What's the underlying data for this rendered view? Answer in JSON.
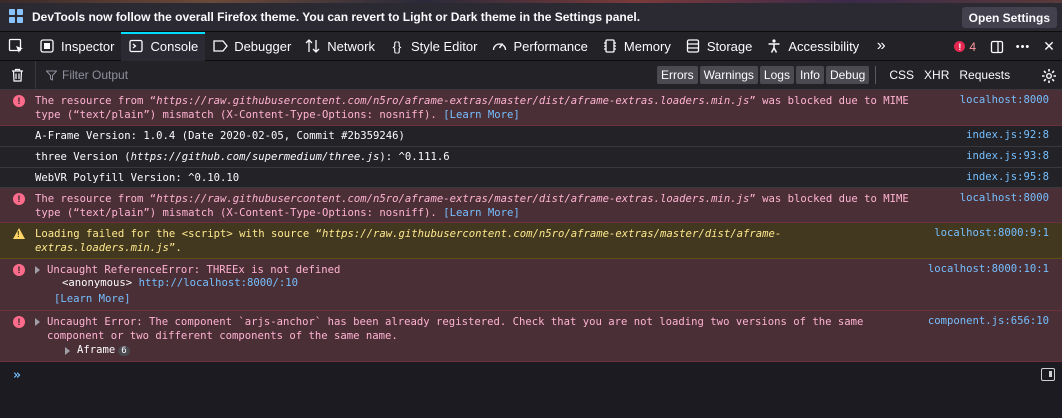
{
  "notification": {
    "text": "DevTools now follow the overall Firefox theme. You can revert to Light or Dark theme in the Settings panel.",
    "button": "Open Settings"
  },
  "toolbox": {
    "tabs": [
      {
        "label": "Inspector",
        "icon": "inspector-icon"
      },
      {
        "label": "Console",
        "icon": "console-icon"
      },
      {
        "label": "Debugger",
        "icon": "debugger-icon"
      },
      {
        "label": "Network",
        "icon": "network-icon"
      },
      {
        "label": "Style Editor",
        "icon": "style-editor-icon"
      },
      {
        "label": "Performance",
        "icon": "performance-icon"
      },
      {
        "label": "Memory",
        "icon": "memory-icon"
      },
      {
        "label": "Storage",
        "icon": "storage-icon"
      },
      {
        "label": "Accessibility",
        "icon": "accessibility-icon"
      }
    ],
    "selected_tab": "Console",
    "more": "»",
    "error_count": "4",
    "more_menu": "•••",
    "close": "✕"
  },
  "filterbar": {
    "placeholder": "Filter Output",
    "levels": [
      "Errors",
      "Warnings",
      "Logs",
      "Info",
      "Debug"
    ],
    "requests": [
      "CSS",
      "XHR",
      "Requests"
    ]
  },
  "messages": [
    {
      "type": "error",
      "pre": "The resource from “",
      "url": "https://raw.githubusercontent.com/n5ro/aframe-extras/master/dist/aframe-extras.loaders.min.js",
      "post": "” was blocked due to MIME",
      "line2": "type (“text/plain”) mismatch (X-Content-Type-Options: nosniff). ",
      "learn": "[Learn More]",
      "location": "localhost:8000"
    },
    {
      "type": "log",
      "text": "A-Frame Version: 1.0.4 (Date 2020-02-05, Commit #2b359246)",
      "location": "index.js:92:8"
    },
    {
      "type": "log",
      "pre": "three Version (",
      "url": "https://github.com/supermedium/three.js",
      "post": "): ^0.111.6",
      "location": "index.js:93:8"
    },
    {
      "type": "log",
      "text": "WebVR Polyfill Version: ^0.10.10",
      "location": "index.js:95:8"
    },
    {
      "type": "error",
      "pre": "The resource from “",
      "url": "https://raw.githubusercontent.com/n5ro/aframe-extras/master/dist/aframe-extras.loaders.min.js",
      "post": "” was blocked due to MIME",
      "line2": "type (“text/plain”) mismatch (X-Content-Type-Options: nosniff). ",
      "learn": "[Learn More]",
      "location": "localhost:8000"
    },
    {
      "type": "warn",
      "pre": "Loading failed for the <script> with source “",
      "url": "https://raw.githubusercontent.com/n5ro/aframe-extras/master/dist/aframe-",
      "line2": "extras.loaders.min.js",
      "post2": "”.",
      "location": "localhost:8000:9:1"
    },
    {
      "type": "error",
      "text": "Uncaught ReferenceError: THREEx is not defined",
      "trace_fn": "<anonymous>",
      "trace_loc": "http://localhost:8000/:10",
      "learn": "[Learn More]",
      "location": "localhost:8000:10:1"
    },
    {
      "type": "error",
      "text": "Uncaught Error: The component `arjs-anchor` has been already registered. Check that you are not loading two versions of the same",
      "line2": "component or two different components of the same name.",
      "trace_fn": "Aframe",
      "trace_count": "6",
      "location": "component.js:656:10"
    }
  ],
  "input": {
    "prompt": "»"
  }
}
